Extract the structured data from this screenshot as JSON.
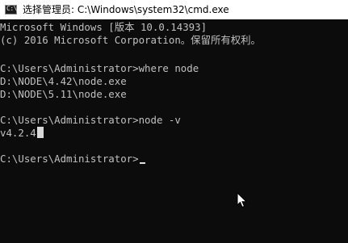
{
  "window": {
    "title": "选择管理员: C:\\Windows\\system32\\cmd.exe",
    "icon": "console-icon",
    "icon_glyph": "C:\\"
  },
  "console": {
    "lines": [
      "Microsoft Windows [版本 10.0.14393]",
      "(c) 2016 Microsoft Corporation。保留所有权利。",
      "",
      "C:\\Users\\Administrator>where node",
      "D:\\NODE\\4.42\\node.exe",
      "D:\\NODE\\5.11\\node.exe",
      "",
      "C:\\Users\\Administrator>node -v",
      "v4.2.4",
      "",
      "C:\\Users\\Administrator>"
    ],
    "text_color": "#c0c0c0",
    "background_color": "#0c0c0c"
  },
  "pointer": {
    "icon": "mouse-pointer-icon"
  }
}
